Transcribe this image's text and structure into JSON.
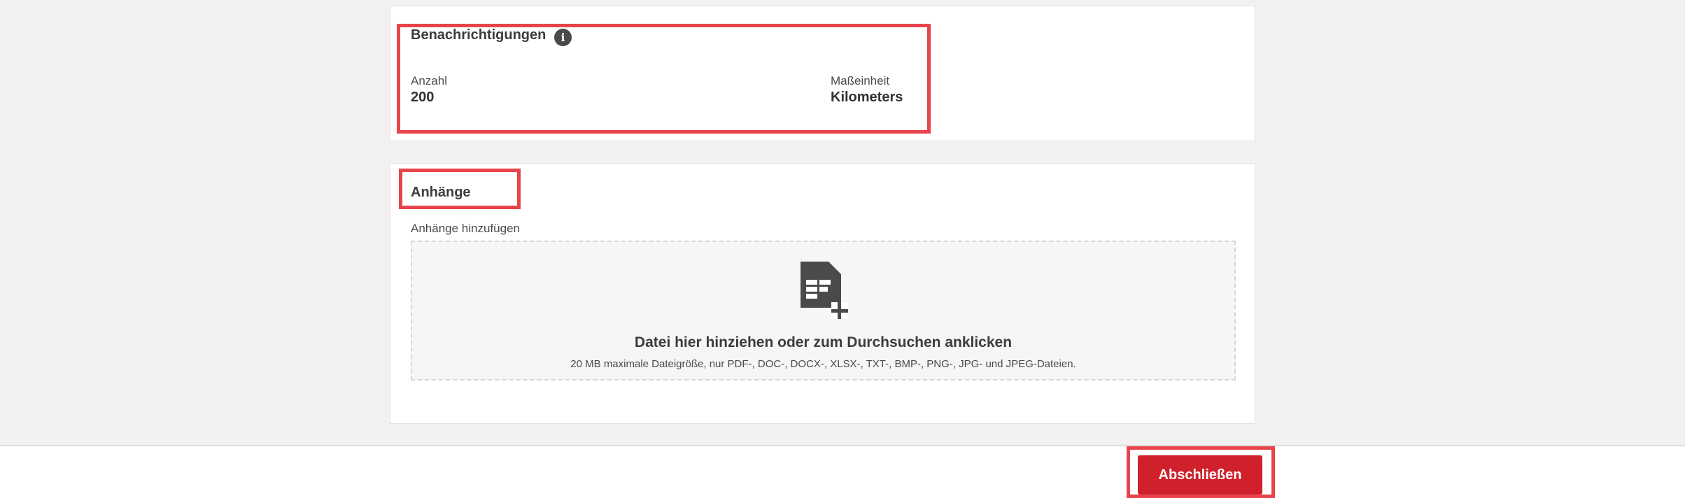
{
  "notifications": {
    "title": "Benachrichtigungen",
    "info_icon": "info-icon",
    "count_label": "Anzahl",
    "count_value": "200",
    "unit_label": "Maßeinheit",
    "unit_value": "Kilometers"
  },
  "attachments": {
    "title": "Anhänge",
    "add_label": "Anhänge hinzufügen",
    "dropzone": {
      "icon": "document-add-icon",
      "title": "Datei hier hinziehen oder zum Durchsuchen anklicken",
      "hint": "20 MB maximale Dateigröße, nur PDF-, DOC-, DOCX-, XLSX-, TXT-, BMP-, PNG-, JPG- und JPEG-Dateien."
    }
  },
  "footer": {
    "submit_label": "Abschließen"
  },
  "colors": {
    "page_background": "#f2f1ef",
    "card_background": "#ffffff",
    "highlight": "#e8444b",
    "primary_button": "#d0202b",
    "icon": "#4a4a4a"
  }
}
